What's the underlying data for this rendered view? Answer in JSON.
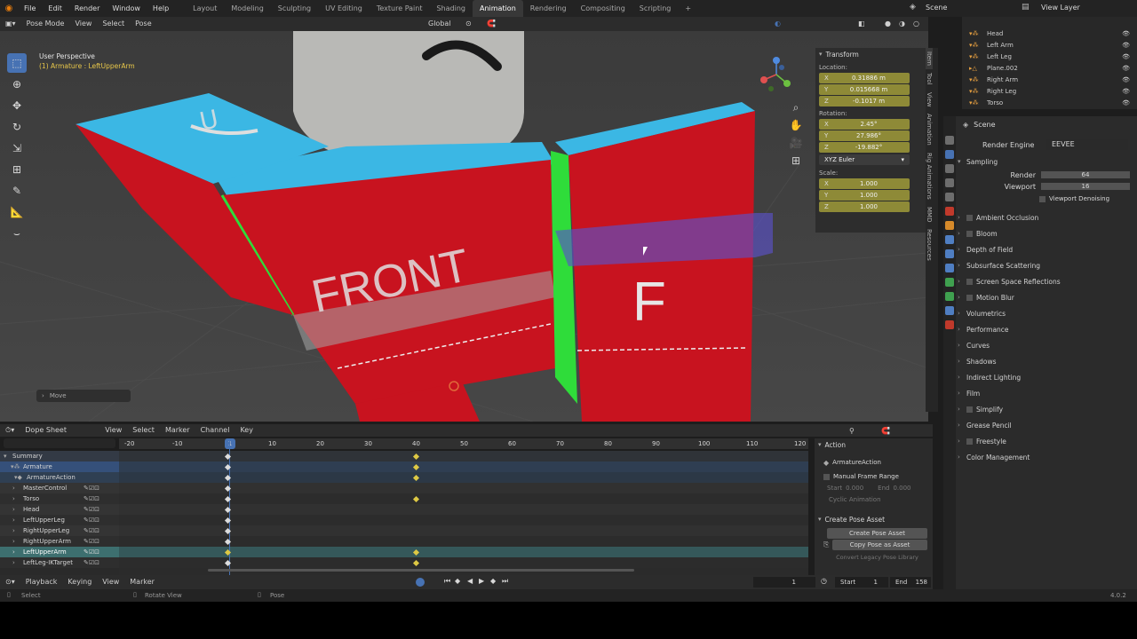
{
  "topbar": {
    "menus": [
      "File",
      "Edit",
      "Render",
      "Window",
      "Help"
    ],
    "workspaces": [
      "Layout",
      "Modeling",
      "Sculpting",
      "UV Editing",
      "Texture Paint",
      "Shading",
      "Animation",
      "Rendering",
      "Compositing",
      "Scripting"
    ],
    "active_workspace": "Animation",
    "add_tab": "+",
    "scene_label": "Scene",
    "viewlayer_label": "View Layer"
  },
  "viewport_header": {
    "mode": "Pose Mode",
    "menus": [
      "View",
      "Select",
      "Pose"
    ],
    "transform_orientation": "Global",
    "pose_options": "Pose Options"
  },
  "viewport": {
    "perspective": "User Perspective",
    "object_info": "(1) Armature : LeftUpperArm",
    "torso_text": "FRONT",
    "arm_letter": "F",
    "shoulder_letter": "U",
    "last_op": "Move"
  },
  "npanel": {
    "tab": "Transform",
    "location_label": "Location:",
    "location": [
      {
        "axis": "X",
        "value": "0.31886 m"
      },
      {
        "axis": "Y",
        "value": "0.015668 m"
      },
      {
        "axis": "Z",
        "value": "-0.1017 m"
      }
    ],
    "rotation_label": "Rotation:",
    "rotation": [
      {
        "axis": "X",
        "value": "2.45°"
      },
      {
        "axis": "Y",
        "value": "27.986°"
      },
      {
        "axis": "Z",
        "value": "-19.882°"
      }
    ],
    "rotation_mode": "XYZ Euler",
    "scale_label": "Scale:",
    "scale": [
      {
        "axis": "X",
        "value": "1.000"
      },
      {
        "axis": "Y",
        "value": "1.000"
      },
      {
        "axis": "Z",
        "value": "1.000"
      }
    ]
  },
  "viewport_tabs": [
    "Item",
    "Tool",
    "View",
    "Animation",
    "Rig Animations",
    "MMD",
    "Resources"
  ],
  "outliner": {
    "items": [
      "Head",
      "Left Arm",
      "Left Leg",
      "Plane.002",
      "Right Arm",
      "Right Leg",
      "Torso"
    ]
  },
  "properties": {
    "scene": "Scene",
    "render_engine_label": "Render Engine",
    "render_engine": "EEVEE",
    "sampling": "Sampling",
    "render_label": "Render",
    "render_value": "64",
    "viewport_label": "Viewport",
    "viewport_value": "16",
    "viewport_denoising": "Viewport Denoising",
    "sections": [
      "Ambient Occlusion",
      "Bloom",
      "Depth of Field",
      "Subsurface Scattering",
      "Screen Space Reflections",
      "Motion Blur",
      "Volumetrics",
      "Performance",
      "Curves",
      "Shadows",
      "Indirect Lighting",
      "Film",
      "Simplify",
      "Grease Pencil",
      "Freestyle",
      "Color Management"
    ]
  },
  "dopesheet": {
    "editor": "Dope Sheet",
    "menus": [
      "View",
      "Select",
      "Marker",
      "Channel",
      "Key"
    ],
    "ruler": [
      "-20",
      "-10",
      "1",
      "10",
      "20",
      "30",
      "40",
      "50",
      "60",
      "70",
      "80",
      "90",
      "100",
      "110",
      "120"
    ],
    "current_frame_label": "1",
    "channels": [
      "Summary",
      "Armature",
      "ArmatureAction",
      "MasterControl",
      "Torso",
      "Head",
      "LeftUpperLeg",
      "RightUpperLeg",
      "RightUpperArm",
      "LeftUpperArm",
      "LeftLeg-IKTarget"
    ],
    "side": {
      "tab": "Action",
      "action_name": "ArmatureAction",
      "manual_frame_range": "Manual Frame Range",
      "start_label": "Start",
      "start_value": "0.000",
      "end_label": "End",
      "end_value": "0.000",
      "cyclic": "Cyclic Animation",
      "create_pose_asset_header": "Create Pose Asset",
      "create_pose_asset": "Create Pose Asset",
      "copy_pose_as_asset": "Copy Pose as Asset",
      "convert_legacy": "Convert Legacy Pose Library"
    }
  },
  "timeline": {
    "menus": [
      "Playback",
      "Keying",
      "View",
      "Marker"
    ],
    "current_frame": "1",
    "start_label": "Start",
    "start_value": "1",
    "end_label": "End",
    "end_value": "158"
  },
  "statusbar": {
    "select": "Select",
    "rotate_view": "Rotate View",
    "pose": "Pose",
    "version": "4.0.2"
  },
  "colors": {
    "accent": "#4772b3",
    "keyframe": "#ddc844",
    "field": "#8e8a37",
    "active_row": "#3d6f6f"
  }
}
